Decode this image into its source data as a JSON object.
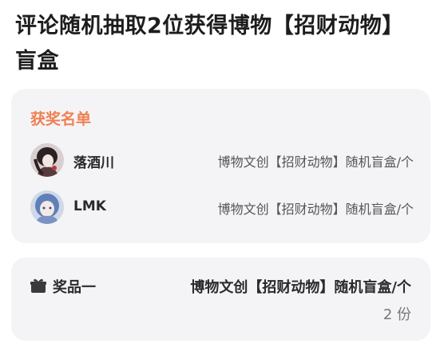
{
  "page": {
    "title": "评论随机抽取2位获得博物【招财动物】盲盒"
  },
  "winners": {
    "heading": "获奖名单",
    "list": [
      {
        "name": "落酒川",
        "prize": "博物文创【招财动物】随机盲盒/个"
      },
      {
        "name": "LMK",
        "prize": "博物文创【招财动物】随机盲盒/个"
      }
    ]
  },
  "prize": {
    "icon": "gift-icon",
    "label": "奖品一",
    "name": "博物文创【招财动物】随机盲盒/个",
    "quantity": "2 份"
  },
  "colors": {
    "accent": "#f07f52",
    "card_bg": "#f4f4f6"
  }
}
